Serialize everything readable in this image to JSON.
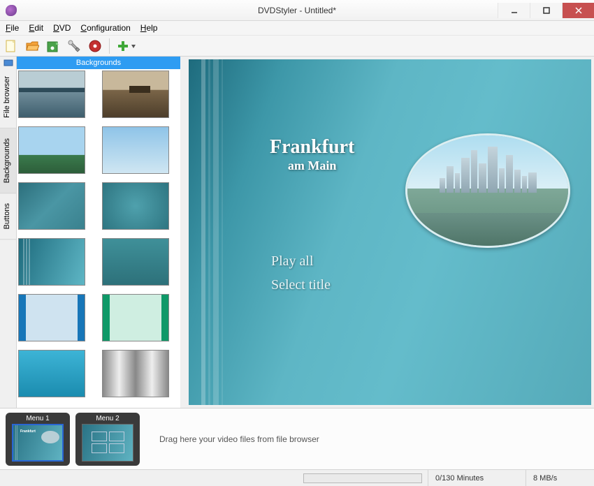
{
  "titlebar": {
    "title": "DVDStyler - Untitled*"
  },
  "menubar": {
    "file": "File",
    "edit": "Edit",
    "dvd": "DVD",
    "configuration": "Configuration",
    "help": "Help"
  },
  "side_tabs": {
    "file_browser": "File browser",
    "backgrounds": "Backgrounds",
    "buttons": "Buttons"
  },
  "backgrounds_panel": {
    "header": "Backgrounds"
  },
  "dvd_menu": {
    "title_main": "Frankfurt",
    "title_sub": "am Main",
    "item_play_all": "Play all",
    "item_select_title": "Select title"
  },
  "timeline": {
    "menu1_label": "Menu 1",
    "menu2_label": "Menu 2",
    "drop_hint": "Drag here your video files from file browser"
  },
  "statusbar": {
    "duration": "0/130 Minutes",
    "bitrate": "8 MB/s"
  }
}
